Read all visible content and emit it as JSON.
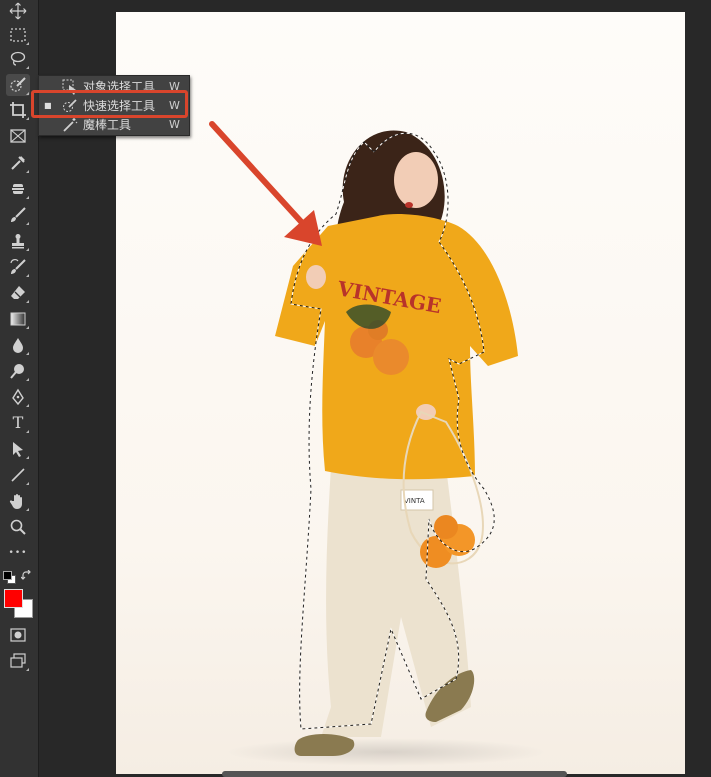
{
  "flyout": {
    "items": [
      {
        "label": "对象选择工具",
        "shortcut": "W",
        "icon": "object-selection-icon",
        "selected": false
      },
      {
        "label": "快速选择工具",
        "shortcut": "W",
        "icon": "quick-selection-icon",
        "selected": true
      },
      {
        "label": "魔棒工具",
        "shortcut": "W",
        "icon": "magic-wand-icon",
        "selected": false
      }
    ]
  },
  "toolbar": {
    "type_tool_glyph": "T",
    "more_glyph": "•••",
    "tools": [
      "move-icon",
      "marquee-icon",
      "lasso-icon",
      "quick-selection-icon",
      "crop-icon",
      "frame-icon",
      "eyedropper-icon",
      "healing-brush-icon",
      "brush-icon",
      "clone-stamp-icon",
      "history-brush-icon",
      "eraser-icon",
      "gradient-icon",
      "blur-icon",
      "dodge-icon",
      "pen-icon",
      "type-icon",
      "path-selection-icon",
      "line-icon",
      "hand-icon",
      "zoom-icon",
      "more-tools-icon",
      "quick-mask-icon",
      "screen-mode-icon"
    ]
  },
  "colors": {
    "foreground": "#ff0000",
    "background": "#ffffff",
    "highlight": "#d9452c",
    "shirt": "#f0a81a",
    "pants": "#ece2cf"
  },
  "canvas": {
    "shirt_text": "VINTAGE",
    "pocket_tag": "VINTA"
  }
}
